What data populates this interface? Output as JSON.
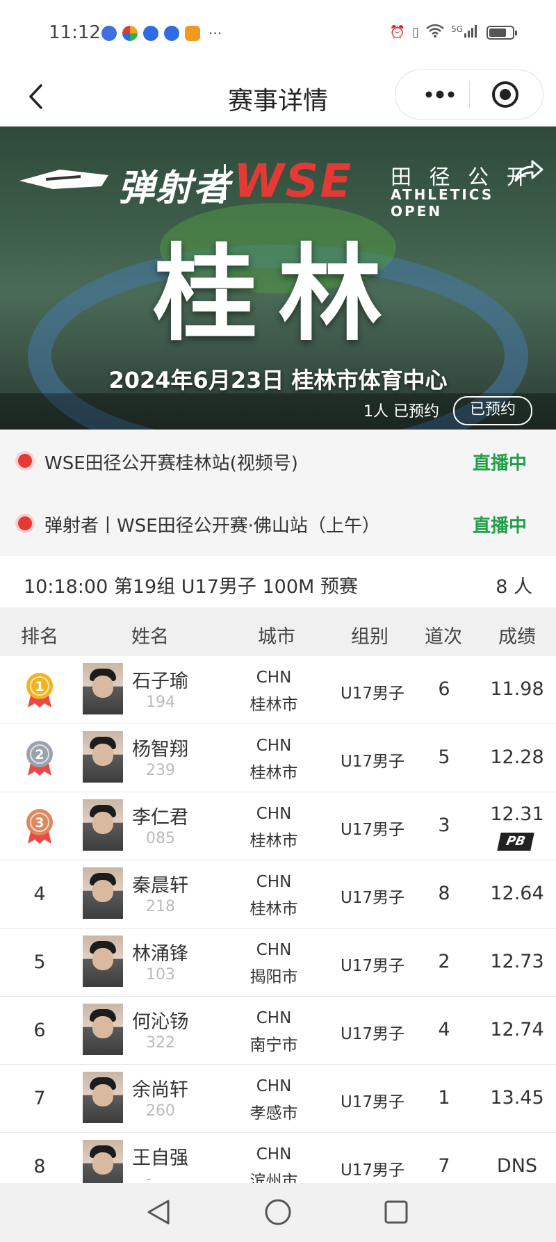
{
  "status_bar": {
    "time": "11:12",
    "app_icons": [
      {
        "name": "music-icon",
        "color": "#3f6fe0"
      },
      {
        "name": "pinwheel-icon",
        "color": "#f0a020"
      },
      {
        "name": "baidu-paw-icon",
        "color": "#2f6be5"
      },
      {
        "name": "baidu-paw-icon",
        "color": "#2f6be5"
      },
      {
        "name": "play-icon",
        "color": "#f39a1e"
      }
    ],
    "more": "···",
    "network": "5G",
    "battery_level": 0.75
  },
  "nav": {
    "title": "赛事详情"
  },
  "banner": {
    "brand_cn": "弹射者",
    "brand_wse": "WSE",
    "meet_name_cn": "田 径 公 开",
    "meet_name_en": "ATHLETICS OPEN",
    "city": "桂林",
    "date_venue": "2024年6月23日  桂林市体育中心",
    "reserve_count": "1人 已预约",
    "reserve_button": "已预约"
  },
  "live_streams": [
    {
      "title": "WSE田径公开赛桂林站(视频号)",
      "status": "直播中"
    },
    {
      "title": "弹射者丨WSE田径公开赛·佛山站（上午）",
      "status": "直播中"
    }
  ],
  "heat": {
    "title": "10:18:00 第19组 U17男子 100M 预赛",
    "count": "8 人"
  },
  "table": {
    "headers": {
      "rank": "排名",
      "name": "姓名",
      "city": "城市",
      "group": "组别",
      "lane": "道次",
      "result": "成绩"
    },
    "rows": [
      {
        "rank": "1",
        "medal": "gold",
        "name": "石子瑜",
        "bib": "194",
        "country": "CHN",
        "city": "桂林市",
        "group": "U17男子",
        "lane": "6",
        "result": "11.98",
        "pb": ""
      },
      {
        "rank": "2",
        "medal": "silver",
        "name": "杨智翔",
        "bib": "239",
        "country": "CHN",
        "city": "桂林市",
        "group": "U17男子",
        "lane": "5",
        "result": "12.28",
        "pb": ""
      },
      {
        "rank": "3",
        "medal": "bronze",
        "name": "李仁君",
        "bib": "085",
        "country": "CHN",
        "city": "桂林市",
        "group": "U17男子",
        "lane": "3",
        "result": "12.31",
        "pb": "PB"
      },
      {
        "rank": "4",
        "medal": "",
        "name": "秦晨轩",
        "bib": "218",
        "country": "CHN",
        "city": "桂林市",
        "group": "U17男子",
        "lane": "8",
        "result": "12.64",
        "pb": ""
      },
      {
        "rank": "5",
        "medal": "",
        "name": "林涌锋",
        "bib": "103",
        "country": "CHN",
        "city": "揭阳市",
        "group": "U17男子",
        "lane": "2",
        "result": "12.73",
        "pb": ""
      },
      {
        "rank": "6",
        "medal": "",
        "name": "何沁钖",
        "bib": "322",
        "country": "CHN",
        "city": "南宁市",
        "group": "U17男子",
        "lane": "4",
        "result": "12.74",
        "pb": ""
      },
      {
        "rank": "7",
        "medal": "",
        "name": "余尚轩",
        "bib": "260",
        "country": "CHN",
        "city": "孝感市",
        "group": "U17男子",
        "lane": "1",
        "result": "13.45",
        "pb": ""
      },
      {
        "rank": "8",
        "medal": "",
        "name": "王自强",
        "bib": "-",
        "country": "CHN",
        "city": "滨州市",
        "group": "U17男子",
        "lane": "7",
        "result": "DNS",
        "pb": ""
      }
    ]
  },
  "colors": {
    "live_red": "#e53935",
    "live_green": "#1fa048",
    "gold": "#f2b41c",
    "silver": "#9aa3ad",
    "bronze": "#e0875a",
    "ribbon": "#e84a4a"
  }
}
